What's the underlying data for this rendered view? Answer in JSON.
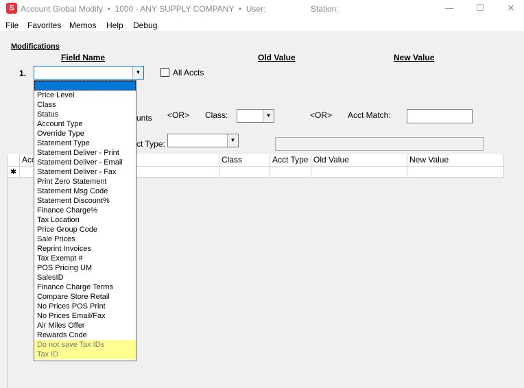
{
  "window": {
    "title": "Account Global Modify  •  1000 - ANY SUPPLY COMPANY  •  User:",
    "station_label": "Station:",
    "icon_letter": "S",
    "minimize": "—",
    "maximize": "☐",
    "close": "✕"
  },
  "menu": [
    "File",
    "Favorites",
    "Memos",
    "Help",
    "Debug"
  ],
  "form": {
    "section_label": "Modifications",
    "field_name_header": "Field Name",
    "old_value_header": "Old Value",
    "new_value_header": "New Value",
    "row_number": "1.",
    "field_name_value": "",
    "all_accts_label": "All Accts",
    "all_accts_checked": false,
    "accounts_label_partial": "unts",
    "or1": "<OR>",
    "class_label": "Class:",
    "class_value": "",
    "or2": "<OR>",
    "acct_match_label": "Acct Match:",
    "acct_match_value": "",
    "acct_type_label_partial": "ct Type:",
    "acct_type_value": ""
  },
  "grid": {
    "columns": [
      "Acc",
      "Class",
      "Acct Type",
      "Old Value",
      "New Value"
    ],
    "new_row_marker": "✱"
  },
  "dropdown": {
    "items": [
      "",
      "Price Level",
      "Class",
      "Status",
      "Account Type",
      "Override Type",
      "Statement Type",
      "Statement Deliver - Print",
      "Statement Deliver - Email",
      "Statement Deliver - Fax",
      "Print Zero Statement",
      "Statement Msg Code",
      "Statement Discount%",
      "Finance Charge%",
      "Tax Location",
      "Price Group Code",
      "Sale Prices",
      "Reprint Invoices",
      "Tax Exempt #",
      "POS Pricing UM",
      "SalesID",
      "Finance Charge Terms",
      "Compare Store Retail",
      "No Prices POS Print",
      "No Prices Email/Fax",
      "Air Miles Offer",
      "Rewards Code",
      "Do not save Tax IDs",
      "Tax ID"
    ],
    "selected_index": 0,
    "highlighted_items": [
      "Do not save Tax IDs",
      "Tax ID"
    ],
    "highlight_color": "#ffff91"
  }
}
